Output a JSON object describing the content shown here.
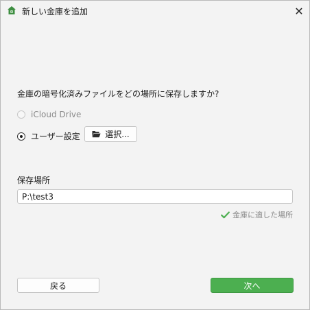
{
  "window": {
    "title": "新しい金庫を追加",
    "close_glyph": "✕"
  },
  "main": {
    "question": "金庫の暗号化済みファイルをどの場所に保存しますか?",
    "options": [
      {
        "label": "iCloud Drive",
        "selected": false,
        "enabled": false
      },
      {
        "label": "ユーザー設定",
        "selected": true,
        "enabled": true
      }
    ],
    "select_button_label": "選択..."
  },
  "storage": {
    "label": "保存場所",
    "path_value": "P:\\test3",
    "status_text": "金庫に適した場所"
  },
  "footer": {
    "back_label": "戻る",
    "next_label": "次へ"
  },
  "colors": {
    "accent": "#4caf50",
    "status_check": "#4caf50"
  },
  "icons": {
    "app": "app-logo-icon",
    "close": "close-icon",
    "folder": "folder-open-icon",
    "check": "checkmark-icon"
  }
}
